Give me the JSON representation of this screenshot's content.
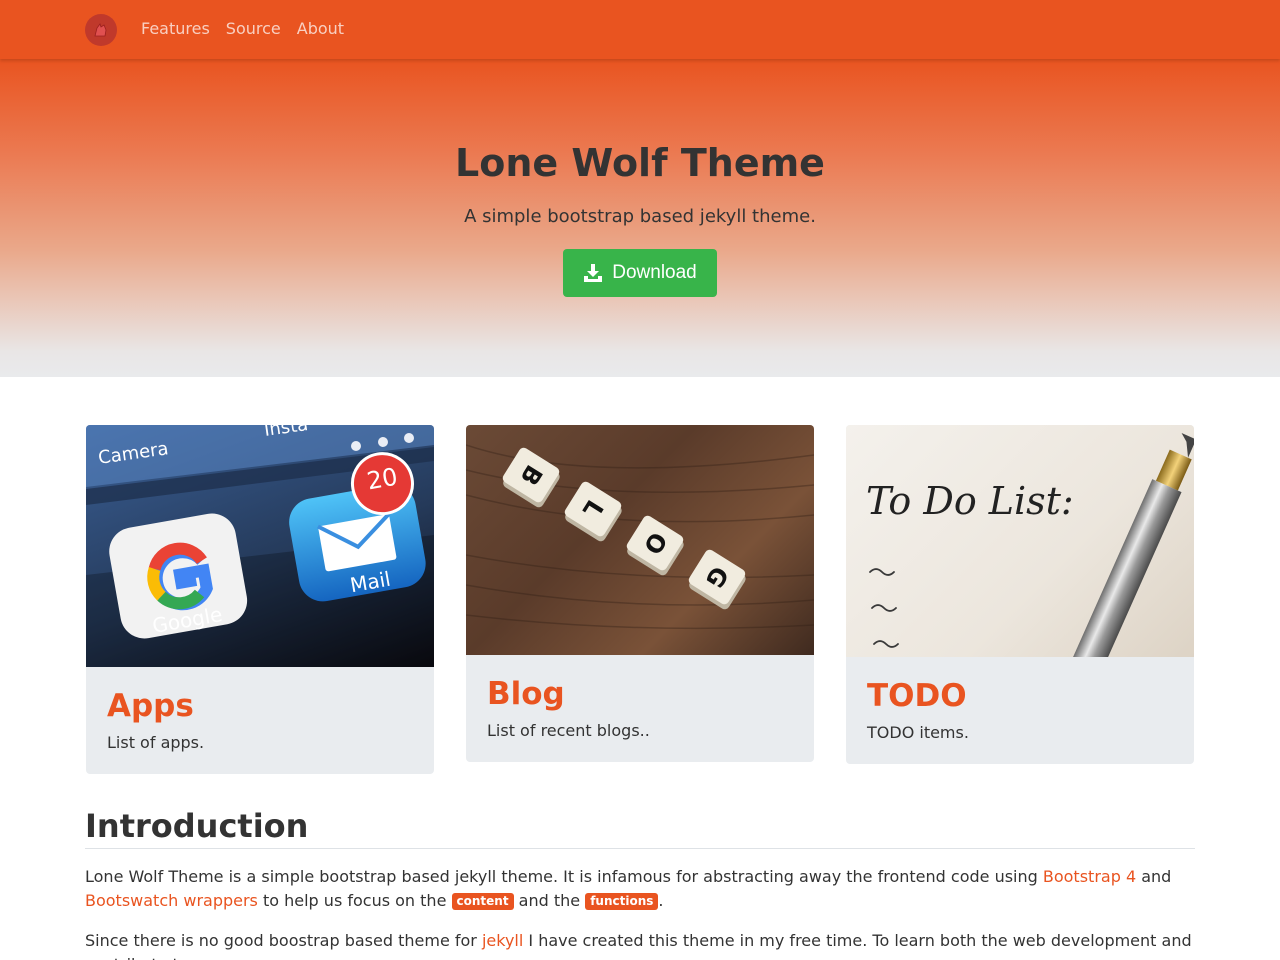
{
  "navbar": {
    "links": [
      {
        "label": "Features"
      },
      {
        "label": "Source"
      },
      {
        "label": "About"
      }
    ]
  },
  "hero": {
    "title": "Lone Wolf Theme",
    "subtitle": "A simple bootstrap based jekyll theme.",
    "button_label": "Download"
  },
  "cards": [
    {
      "title": "Apps",
      "text": "List of apps.",
      "image": {
        "camera": "Camera",
        "instagram": "Insta",
        "google": "Google",
        "mail": "Mail",
        "badge": "20"
      }
    },
    {
      "title": "Blog",
      "text": "List of recent blogs..",
      "image": {
        "tiles": [
          "B",
          "L",
          "O",
          "G"
        ]
      }
    },
    {
      "title": "TODO",
      "text": "TODO items.",
      "image": {
        "heading": "To Do List:"
      }
    }
  ],
  "intro": {
    "title": "Introduction",
    "p1": {
      "t1": "Lone Wolf Theme is a simple bootstrap based jekyll theme. It is infamous for abstracting away the frontend code using ",
      "link1": "Bootstrap 4",
      "t2": " and ",
      "link2": "Bootswatch wrappers",
      "t3": " to help us focus on the ",
      "badge1": "content",
      "t4": " and the ",
      "badge2": "functions",
      "t5": "."
    },
    "p2": {
      "t1": "Since there is no good boostrap based theme for ",
      "link1": "jekyll",
      "t2": " I have created this theme in my free time. To learn both the web development and contribute to"
    }
  },
  "colors": {
    "accent": "#e95420",
    "success": "#38b44a",
    "card_bg": "#e9ecef"
  }
}
